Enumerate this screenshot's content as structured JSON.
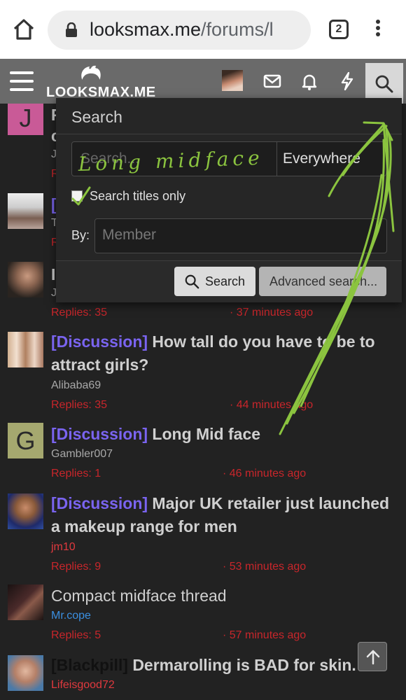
{
  "browser": {
    "url_host": "looksmax.me",
    "url_path": "/forums/l",
    "tab_count": "2"
  },
  "site": {
    "logo_text": "LOOKSMAX.ME"
  },
  "search_menu": {
    "title": "Search",
    "query_placeholder": "Search...",
    "scope_selected": "Everywhere",
    "titles_only_label": "Search titles only",
    "titles_only_checked": true,
    "by_label": "By:",
    "member_placeholder": "Member",
    "search_button": "Search",
    "advanced_button": "Advanced search..."
  },
  "handwriting": {
    "text": "Long midface",
    "color": "#8bc43f"
  },
  "obscured_rows": [
    {
      "letter": "J",
      "title_char": "F",
      "line2_char": "c",
      "author_char": "J",
      "meta_char": "R"
    },
    {
      "title_char": "[",
      "author_char": "T",
      "meta_char": "R"
    },
    {
      "title_char": "I",
      "author_char": "J"
    }
  ],
  "row3_meta": {
    "replies": "Replies: 35",
    "time": "· 37 minutes ago"
  },
  "threads": [
    {
      "prefix": "[Discussion]",
      "title": "How tall do you have to be to attract girls?",
      "author": "Alibaba69",
      "replies": "Replies: 35",
      "time": "· 44 minutes ago"
    },
    {
      "prefix": "[Discussion]",
      "title": "Long Mid face",
      "author": "Gambler007",
      "replies": "Replies: 1",
      "time": "· 46 minutes ago",
      "avatar_letter": "G"
    },
    {
      "prefix": "[Discussion]",
      "title": "Major UK retailer just launched a makeup range for men",
      "author": "jm10",
      "replies": "Replies: 9",
      "time": "· 53 minutes ago"
    },
    {
      "prefix": "",
      "title": "Compact midface thread",
      "author": "Mr.cope",
      "replies": "Replies: 5",
      "time": "· 57 minutes ago"
    },
    {
      "prefix": "[Blackpill]",
      "title": "Dermarolling is BAD for skin.",
      "author": "Lifeisgood72"
    }
  ],
  "colors": {
    "background": "#222222",
    "nav": "#6a6a6a",
    "prefix_discussion": "#7a64f0",
    "meta_red": "#c8262b",
    "annotation_green": "#8bc43f"
  },
  "icons": [
    "home-icon",
    "lock-icon",
    "tabs-icon",
    "more-vert-icon",
    "menu-icon",
    "mail-icon",
    "bell-icon",
    "bolt-icon",
    "search-icon",
    "arrow-up-icon"
  ]
}
